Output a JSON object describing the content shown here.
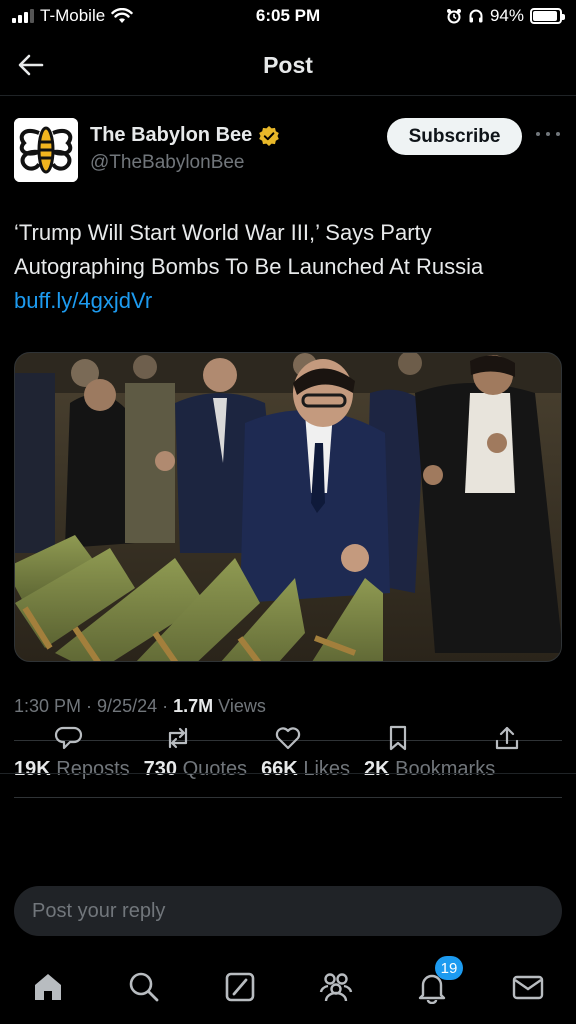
{
  "status_bar": {
    "carrier": "T-Mobile",
    "time": "6:05 PM",
    "battery": "94%",
    "battery_level": 0.94
  },
  "header": {
    "title": "Post"
  },
  "post": {
    "author_name": "The Babylon Bee",
    "author_handle": "@TheBabylonBee",
    "subscribe_label": "Subscribe",
    "text": "‘Trump Will Start World War III,’ Says Party Autographing Bombs To Be Launched At Russia",
    "link": "buff.ly/4gxjdVr",
    "time": "1:30 PM",
    "date": "9/25/24",
    "views_count": "1.7M",
    "views_label": "Views"
  },
  "stats": {
    "reposts_count": "19K",
    "reposts_label": "Reposts",
    "quotes_count": "730",
    "quotes_label": "Quotes",
    "likes_count": "66K",
    "likes_label": "Likes",
    "bookmarks_count": "2K",
    "bookmarks_label": "Bookmarks"
  },
  "reply": {
    "placeholder": "Post your reply"
  },
  "tabbar": {
    "notifications_badge": "19"
  },
  "colors": {
    "background": "#000000",
    "accent": "#1d9bf0",
    "verified_badge": "#e8b829",
    "secondary_text": "#71767b"
  },
  "icons": {
    "header": [
      "back-arrow-icon"
    ],
    "actions": [
      "reply-icon",
      "repost-icon",
      "like-icon",
      "bookmark-icon",
      "share-icon"
    ],
    "tabbar": [
      "home-icon",
      "search-icon",
      "grok-icon",
      "communities-icon",
      "notifications-icon",
      "messages-icon"
    ]
  }
}
